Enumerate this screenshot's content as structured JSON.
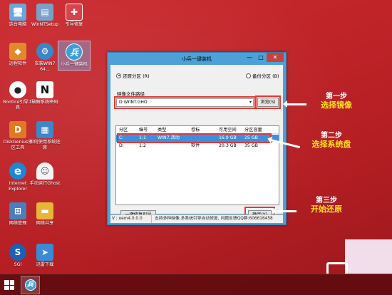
{
  "desktop": {
    "icons": [
      {
        "label": "这台电脑",
        "glyph": "🖥",
        "color": "#6aa7dc",
        "icon": "computer-icon"
      },
      {
        "label": "WinNTSetup",
        "glyph": "▤",
        "color": "#7aa0c8",
        "icon": "setup-icon"
      },
      {
        "label": "引导修复",
        "glyph": "✚",
        "color": "#d9434c",
        "icon": "repair-kit-icon"
      },
      {
        "label": "远程软件",
        "glyph": "◆",
        "color": "#e08a2c",
        "icon": "remote-icon"
      },
      {
        "label": "安装WIN7 64...",
        "glyph": "⚙",
        "color": "#3a86c8",
        "icon": "install-icon"
      },
      {
        "label": "小兵一键装机",
        "glyph": "兵",
        "color": "#3d9ed8",
        "icon": "xiaobing-icon"
      },
      {
        "label": "Bootice引导工具",
        "glyph": "●",
        "color": "#222222",
        "icon": "bootice-icon"
      },
      {
        "label": "破解系统密码",
        "glyph": "N",
        "color": "#111111",
        "icon": "password-icon"
      },
      {
        "label": "DiskGenius分区工具",
        "glyph": "D",
        "color": "#e07a22",
        "icon": "diskgenius-icon"
      },
      {
        "label": "如何使用系统还原",
        "glyph": "▦",
        "color": "#3a88c8",
        "icon": "help-icon"
      },
      {
        "label": "Internet Explorer",
        "glyph": "e",
        "color": "#1e86d6",
        "icon": "ie-icon"
      },
      {
        "label": "手动运行Ghost",
        "glyph": "👻",
        "color": "#ffffff",
        "icon": "ghost-icon"
      },
      {
        "label": "网络管理",
        "glyph": "⊞",
        "color": "#4c7ebd",
        "icon": "network-icon"
      },
      {
        "label": "网络共享",
        "glyph": "▬",
        "color": "#e6b53a",
        "icon": "share-folder-icon"
      },
      {
        "label": "SGI",
        "glyph": "S",
        "color": "#1d5fb3",
        "icon": "sgi-icon"
      },
      {
        "label": "迅雷下载",
        "glyph": "➤",
        "color": "#3a8ad6",
        "icon": "thunder-icon"
      }
    ]
  },
  "window": {
    "title": "小兵一键装机",
    "controls": {
      "minimize": "—",
      "maximize": "□",
      "close": "✕"
    },
    "restore_label": "还原分区 (R)",
    "backup_label": "备份分区 (B)",
    "image_path_label": "映像文件路径",
    "image_path_value": "D:\\WINT.GHO",
    "dropdown_arrow": "▾",
    "browse_label": "浏览(S)",
    "table": {
      "headers": [
        "分区",
        "编号",
        "类型",
        "卷标",
        "可用空间",
        "分区容量"
      ],
      "rows": [
        [
          "C:",
          "1:1",
          "WIN7,活动",
          "",
          "16.9 GB",
          "25 GB"
        ],
        [
          "D:",
          "1:2",
          "",
          "软件",
          "20.3 GB",
          "35 GB"
        ]
      ]
    },
    "repair_button": "一键修复引导",
    "ok_button": "确定(Y)",
    "status_version": "V : oem4.0.0.0",
    "status_message": "支持多种映像,多系统引导自动修复, 问题反馈QQ群:606616458"
  },
  "annotations": [
    {
      "step": "第一步",
      "text": "选择镜像"
    },
    {
      "step": "第二步",
      "text": "选择系统盘"
    },
    {
      "step": "第三步",
      "text": "开始还原"
    }
  ],
  "taskbar": {
    "app_glyph": "兵"
  }
}
